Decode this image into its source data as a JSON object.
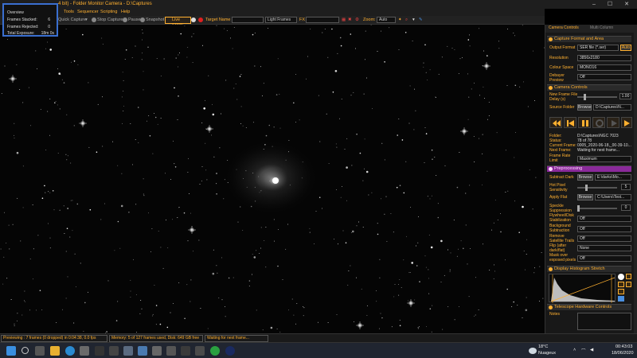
{
  "window": {
    "title": "4 bit) - Folder Monitor Camera - D:\\Captures"
  },
  "menu": [
    "Tools",
    "Sequencer",
    "Scripting",
    "Help"
  ],
  "toolbar": {
    "quick_capture": "Quick Capture",
    "stop_capture": "Stop Capture",
    "pause": "Pause",
    "snapshot": "Snapshot",
    "live_stack": "Live Stack",
    "target_name_label": "Target Name :",
    "target_name_value": "",
    "frame_type": "Light Frames",
    "fx_label": "FX",
    "fx_value": "",
    "zoom_label": "Zoom:",
    "zoom_value": "Auto"
  },
  "stats": {
    "title": "Overview",
    "frames_stacked_label": "Frames Stacked:",
    "frames_stacked": "6",
    "frames_rejected_label": "Frames Rejected:",
    "frames_rejected": "0",
    "total_exposure_label": "Total Exposure:",
    "total_exposure": "18m 0s"
  },
  "panel": {
    "tab_camera_controls": "Camera Controls",
    "tab_multi_column": "Multi Column",
    "capture_section": "Capture Format and Area",
    "output_format_label": "Output Format",
    "output_format": "SER file (*.ser)",
    "auto_btn": "Auto",
    "resolution_label": "Resolution",
    "resolution": "3856x2180",
    "colour_space_label": "Colour Space",
    "colour_space": "MONO16",
    "debayer_label": "Debayer Preview",
    "debayer": "Off",
    "camera_controls_section": "Camera Controls",
    "new_frame_label": "New Frame File Delay (s)",
    "new_frame_value": "1.00",
    "source_folder_label": "Source Folder",
    "browse": "Browse",
    "source_folder": "D:\\Captures\\N...",
    "folder_label": "Folder:",
    "folder": "D:\\Captures\\NGC 7023",
    "status_label": "Status:",
    "status": "78 of 78",
    "current_frame_label": "Current Frame:",
    "current_frame": "0005_2020-06-18,_00-39-10...",
    "next_frame_label": "Next Frame:",
    "next_frame": "Waiting for next frame...",
    "frame_rate_label": "Frame Rate Limit",
    "frame_rate": "Maximum",
    "preprocessing_section": "Preprocessing",
    "subtract_dark_label": "Subtract Dark",
    "subtract_dark": "E:\\darks\\Mo...",
    "hot_pixel_label": "Hot Pixel Sensitivity",
    "hot_pixel_value": "5",
    "apply_flat_label": "Apply Flat",
    "apply_flat": "C:\\Users\\Test...",
    "speckle_label": "Speckle Suppression",
    "speckle_value": "0",
    "flywheel_label": "Flywheel/Disk Stabilization",
    "flywheel": "Off",
    "background_label": "Background Subtraction",
    "background": "Off",
    "remove_sat_label": "Remove Satellite Trails",
    "remove_sat": "Off",
    "flip_label": "Flip (after dark/flat)",
    "flip": "None",
    "mask_label": "Mask over exposed pixels",
    "mask": "Off",
    "histogram_section": "Display Histogram Stretch",
    "telescope_section": "Telescope Hardware Controls",
    "notes_label": "Notes"
  },
  "statusbar": {
    "preview": "Previewing : 7 frames (0 dropped) in 0:04:38, 0.0 fps",
    "memory": "Memory: 5 of 127 frames used, Disk: 649 GB free",
    "waiting": "Waiting for next frame..."
  },
  "taskbar": {
    "weather_temp": "18°C",
    "weather_desc": "Nuageux",
    "time": "00:43:03",
    "date": "18/06/2020"
  },
  "colors": {
    "accent": "#ffb030",
    "panel_bg": "#181818",
    "preprocess_header": "#8a2a9a"
  }
}
